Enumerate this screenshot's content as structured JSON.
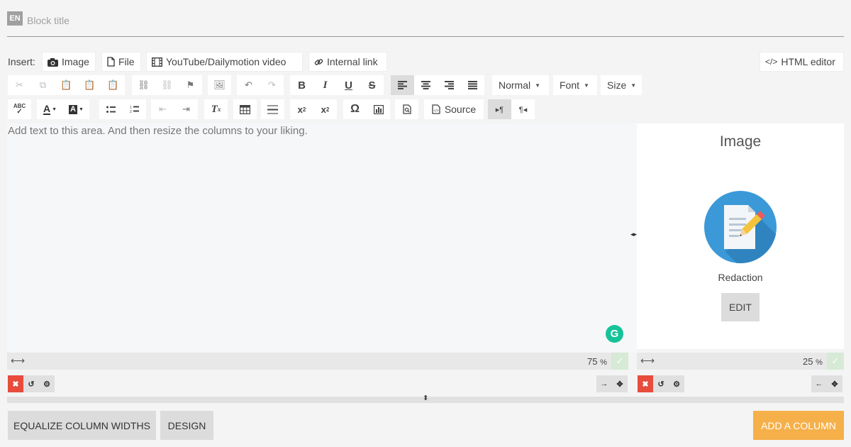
{
  "title_row": {
    "lang_badge": "EN",
    "placeholder": "Block title"
  },
  "insert_bar": {
    "label": "Insert:",
    "buttons": [
      {
        "label": "Image",
        "icon": "camera-icon"
      },
      {
        "label": "File",
        "icon": "file-icon"
      },
      {
        "label": "YouTube/Dailymotion video",
        "icon": "film-icon"
      },
      {
        "label": "Internal link",
        "icon": "link-icon"
      }
    ],
    "html_editor_label": "HTML editor"
  },
  "toolbar": {
    "format_label": "Normal",
    "font_label": "Font",
    "size_label": "Size",
    "source_label": "Source",
    "spellcheck_label": "ABC",
    "text_color_label": "A",
    "bg_color_label": "A"
  },
  "editor": {
    "placeholder": "Add text to this area. And then resize the columns to your liking.",
    "grammarly_label": "G"
  },
  "right_column": {
    "title": "Image",
    "caption": "Redaction",
    "edit_label": "EDIT"
  },
  "columns": [
    {
      "width_percent": "75",
      "unit": "%"
    },
    {
      "width_percent": "25",
      "unit": "%"
    }
  ],
  "footer": {
    "equalize_label": "EQUALIZE COLUMN WIDTHS",
    "design_label": "DESIGN",
    "add_column_label": "ADD A COLUMN"
  },
  "colors": {
    "accent_orange": "#f6b04a",
    "danger_red": "#e74c3c",
    "image_blue": "#3b99d8",
    "grammarly_green": "#15c39a"
  }
}
